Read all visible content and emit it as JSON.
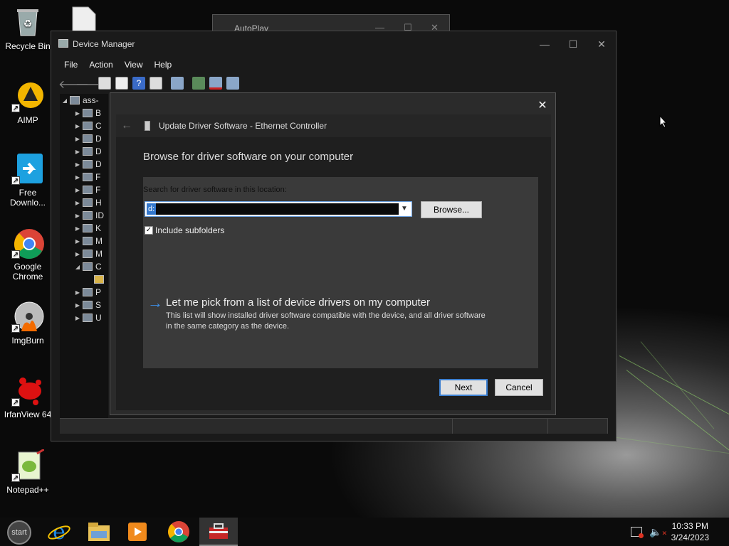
{
  "desktop": {
    "icons": [
      {
        "label": "Recycle Bin",
        "icon": "recycle-bin-icon"
      },
      {
        "label": "AIMP",
        "icon": "aimp-icon"
      },
      {
        "label": "Free Downlo...",
        "icon": "free-download-icon"
      },
      {
        "label": "Google Chrome",
        "icon": "chrome-icon"
      },
      {
        "label": "ImgBurn",
        "icon": "imgburn-icon"
      },
      {
        "label": "IrfanView 64",
        "icon": "irfanview-icon"
      },
      {
        "label": "Notepad++",
        "icon": "notepadpp-icon"
      }
    ]
  },
  "autoplay": {
    "title": "AutoPlay"
  },
  "device_manager": {
    "title": "Device Manager",
    "menu": [
      "File",
      "Action",
      "View",
      "Help"
    ],
    "tree_root": "ass-",
    "tree_items": [
      "B",
      "C",
      "D",
      "D",
      "D",
      "F",
      "F",
      "H",
      "ID",
      "K",
      "M",
      "M",
      "C",
      "",
      "P",
      "S",
      "U"
    ]
  },
  "dialog": {
    "header_title": "Update Driver Software - Ethernet Controller",
    "heading": "Browse for driver software on your computer",
    "search_label": "Search for driver software in this location:",
    "path_value": "d:",
    "browse_label": "Browse...",
    "include_subfolders_label": "Include subfolders",
    "include_subfolders_checked": true,
    "pick_title": "Let me pick from a list of device drivers on my computer",
    "pick_desc": "This list will show installed driver software compatible with the device, and all driver software in the same category as the device.",
    "next_label": "Next",
    "cancel_label": "Cancel"
  },
  "taskbar": {
    "start_label": "start",
    "apps": [
      "internet-explorer-icon",
      "file-explorer-icon",
      "media-player-icon",
      "chrome-icon",
      "toolbox-icon"
    ],
    "time": "10:33 PM",
    "date": "3/24/2023"
  }
}
